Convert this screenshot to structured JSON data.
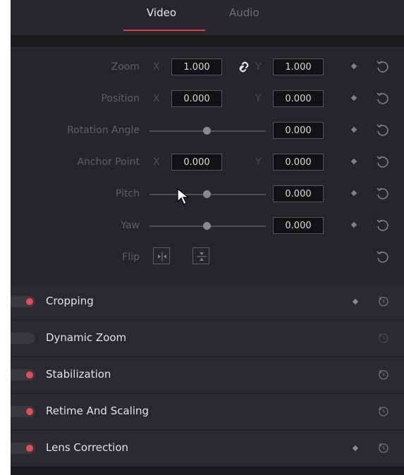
{
  "tabs": [
    {
      "label": "Video",
      "active": true
    },
    {
      "label": "Audio",
      "active": false
    }
  ],
  "transform": {
    "zoom": {
      "label": "Zoom",
      "x_axis": "X",
      "x": "1.000",
      "y_axis": "Y",
      "y": "1.000",
      "link_icon": "link-icon"
    },
    "position": {
      "label": "Position",
      "x_axis": "X",
      "x": "0.000",
      "y_axis": "Y",
      "y": "0.000"
    },
    "rotation": {
      "label": "Rotation Angle",
      "value": "0.000",
      "slider": 0.5
    },
    "anchor": {
      "label": "Anchor Point",
      "x_axis": "X",
      "x": "0.000",
      "y_axis": "Y",
      "y": "0.000"
    },
    "pitch": {
      "label": "Pitch",
      "value": "0.000",
      "slider": 0.5
    },
    "yaw": {
      "label": "Yaw",
      "value": "0.000",
      "slider": 0.5
    },
    "flip": {
      "label": "Flip",
      "horizontal_icon": "flip-horizontal-icon",
      "vertical_icon": "flip-vertical-icon"
    }
  },
  "sections": [
    {
      "title": "Cropping",
      "enabled": true,
      "keyframe": true
    },
    {
      "title": "Dynamic Zoom",
      "enabled": false,
      "keyframe": false
    },
    {
      "title": "Stabilization",
      "enabled": true,
      "keyframe": false
    },
    {
      "title": "Retime And Scaling",
      "enabled": true,
      "keyframe": false
    },
    {
      "title": "Lens Correction",
      "enabled": true,
      "keyframe": true
    }
  ],
  "colors": {
    "accent": "#e84a4f",
    "panel": "#26262a",
    "text": "#e2e2e2",
    "dim_label": "#5d5d63"
  }
}
